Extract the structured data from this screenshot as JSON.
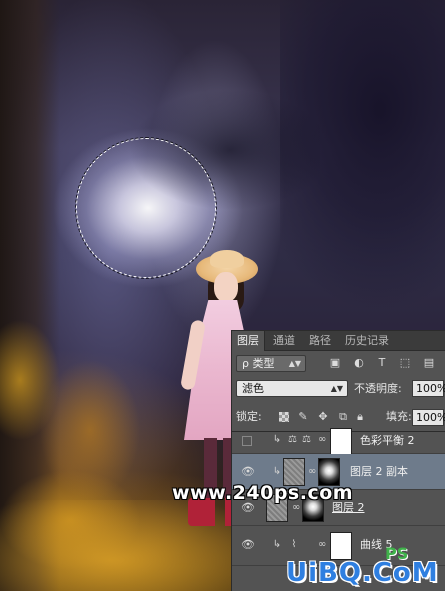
{
  "panel": {
    "tabs": [
      "图层",
      "通道",
      "路径",
      "历史记录"
    ],
    "active_tab": 0,
    "filter": {
      "kind_label": "ρ 类型",
      "icons": [
        "image-filter-icon",
        "adjustment-filter-icon",
        "type-filter-icon",
        "shape-filter-icon",
        "smart-object-filter-icon"
      ]
    },
    "blend": {
      "mode": "滤色",
      "opacity_label": "不透明度:",
      "opacity_value": "100%"
    },
    "lock": {
      "label": "锁定:",
      "fill_label": "填充:",
      "fill_value": "100%"
    },
    "layers": [
      {
        "name": "色彩平衡 2",
        "visible": false,
        "type": "balance"
      },
      {
        "name": "图层 2 副本",
        "visible": true,
        "selected": true,
        "type": "pixel-masked"
      },
      {
        "name": "图层 2",
        "visible": true,
        "type": "pixel-masked"
      },
      {
        "name": "曲线 5",
        "visible": true,
        "type": "curves"
      }
    ]
  },
  "watermarks": {
    "site": "www.240ps.com",
    "brand": "UiBQ.CoM",
    "brand_ps": "PS"
  },
  "colors": {
    "panel_bg": "#535353",
    "selected_row": "#6e7b8b",
    "brand_blue": "#2f7fe0",
    "brand_green": "#3fb24a"
  }
}
